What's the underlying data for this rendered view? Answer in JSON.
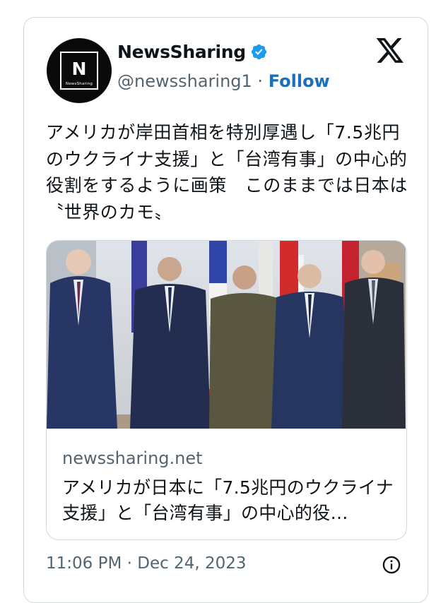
{
  "author": {
    "display_name": "NewsSharing",
    "handle": "@newssharing1",
    "separator": "·",
    "follow_label": "Follow",
    "avatar_letter": "N",
    "avatar_caption": "NewsSharing",
    "verified_icon": "verified-badge-icon"
  },
  "platform_icon": "x-logo-icon",
  "tweet": {
    "text": "アメリカが岸田首相を特別厚遇し「7.5兆円のウクライナ支援」と「台湾有事」の中心的役割をするように画策　このままでは日本は〝世界のカモ〟"
  },
  "link_card": {
    "domain": "newssharing.net",
    "title": "アメリカが日本に「7.5兆円のウクライナ支援」と「台湾有事」の中心的役…"
  },
  "footer": {
    "timestamp": "11:06 PM · Dec 24, 2023",
    "info_icon": "info-icon"
  },
  "colors": {
    "text_primary": "#0f1419",
    "text_secondary": "#536471",
    "follow": "#1d6fb8",
    "verified": "#1d9bf0",
    "border": "#cfd9de"
  }
}
